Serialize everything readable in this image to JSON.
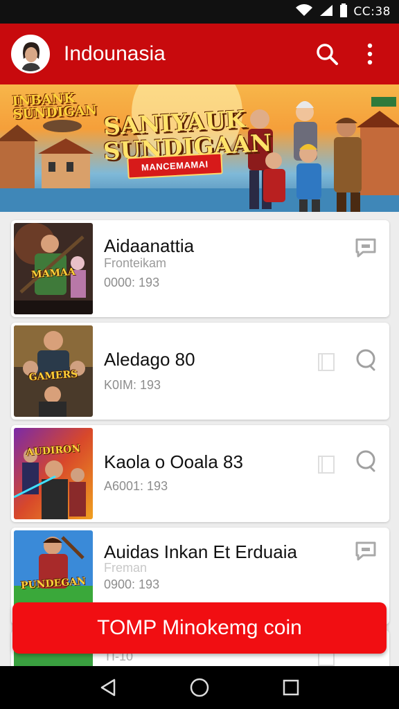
{
  "status_bar": {
    "time": "CC:38"
  },
  "app_bar": {
    "title": "Indounasia"
  },
  "banner": {
    "small_title": "INBANK SUNDIGAN",
    "title": "SANIYAUK SUNDIGAAN",
    "ribbon": "MANCEMAMAI"
  },
  "cards": [
    {
      "title": "Aidaanattia",
      "subtitle": "Fronteikam",
      "meta": "0000: 193",
      "thumb_label": "MAMAA"
    },
    {
      "title": "Aledago 80",
      "subtitle": "",
      "meta": "K0IM: 193",
      "thumb_label": "GAMERS"
    },
    {
      "title": "Kaola o Ooala 83",
      "subtitle": "",
      "meta": "A6001: 193",
      "thumb_label": "AUDIRON"
    },
    {
      "title": "Auidas Inkan Et Erduaia",
      "subtitle": "Freman",
      "meta": "0900: 193",
      "thumb_label": "PUNDEGAN"
    },
    {
      "title": "",
      "subtitle": "",
      "meta": "TI-10",
      "thumb_label": ""
    }
  ],
  "cta": {
    "label": "TOMP Minokemg coin"
  },
  "icons": {
    "search": "search-icon",
    "more": "more-vert-icon",
    "chat": "chat-bubble-icon",
    "doc": "document-icon",
    "back": "back-triangle-icon",
    "home": "home-circle-icon",
    "recents": "recents-square-icon"
  },
  "colors": {
    "app_bar": "#c80a0d",
    "cta": "#f10e12",
    "status_bar": "#111111"
  }
}
